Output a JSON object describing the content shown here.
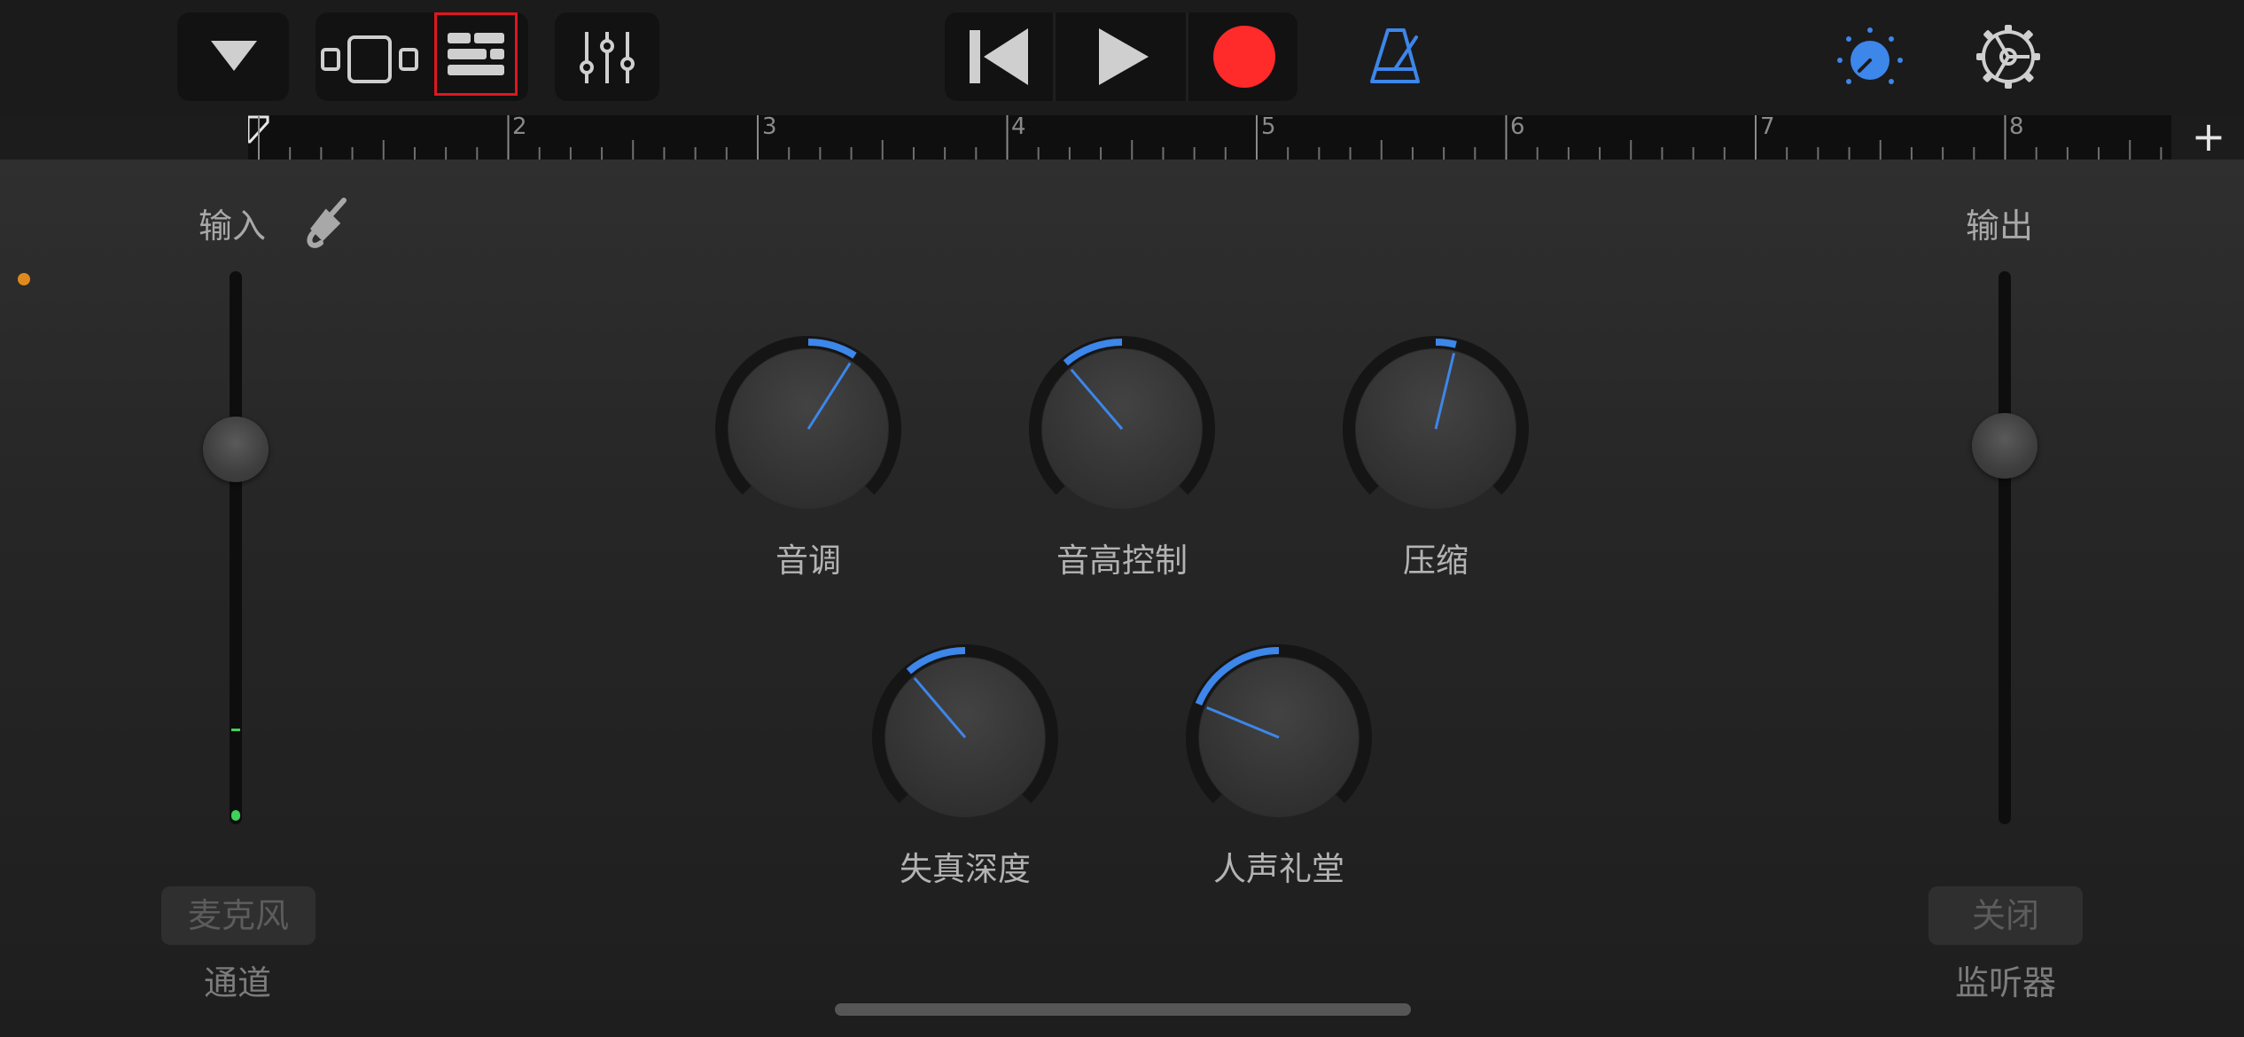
{
  "ruler": {
    "bars": [
      "2",
      "3",
      "4",
      "5",
      "6",
      "7",
      "8"
    ],
    "add_label": "+"
  },
  "input": {
    "label": "输入",
    "channel_button": "麦克风",
    "channel_caption": "通道"
  },
  "output": {
    "label": "输出",
    "monitor_button": "关闭",
    "monitor_caption": "监听器"
  },
  "knobs": [
    {
      "label": "音调",
      "value": 0.62
    },
    {
      "label": "音高控制",
      "value": 0.35
    },
    {
      "label": "压缩",
      "value": 0.55
    },
    {
      "label": "失真深度",
      "value": 0.35
    },
    {
      "label": "人声礼堂",
      "value": 0.25
    }
  ],
  "sliders": {
    "input_level": 0.67,
    "output_level": 0.69
  },
  "colors": {
    "accent": "#3d86ea",
    "record": "#ff2a2a",
    "highlight_box": "#e0161f",
    "level_green": "#3fd15a",
    "input_dot": "#e08a1e"
  },
  "icons": [
    "dropdown-triangle-icon",
    "tracks-view-icon",
    "track-controls-icon",
    "mixer-icon",
    "rewind-icon",
    "play-icon",
    "record-icon",
    "metronome-icon",
    "master-effects-icon",
    "settings-gear-icon",
    "guitar-cable-icon"
  ]
}
